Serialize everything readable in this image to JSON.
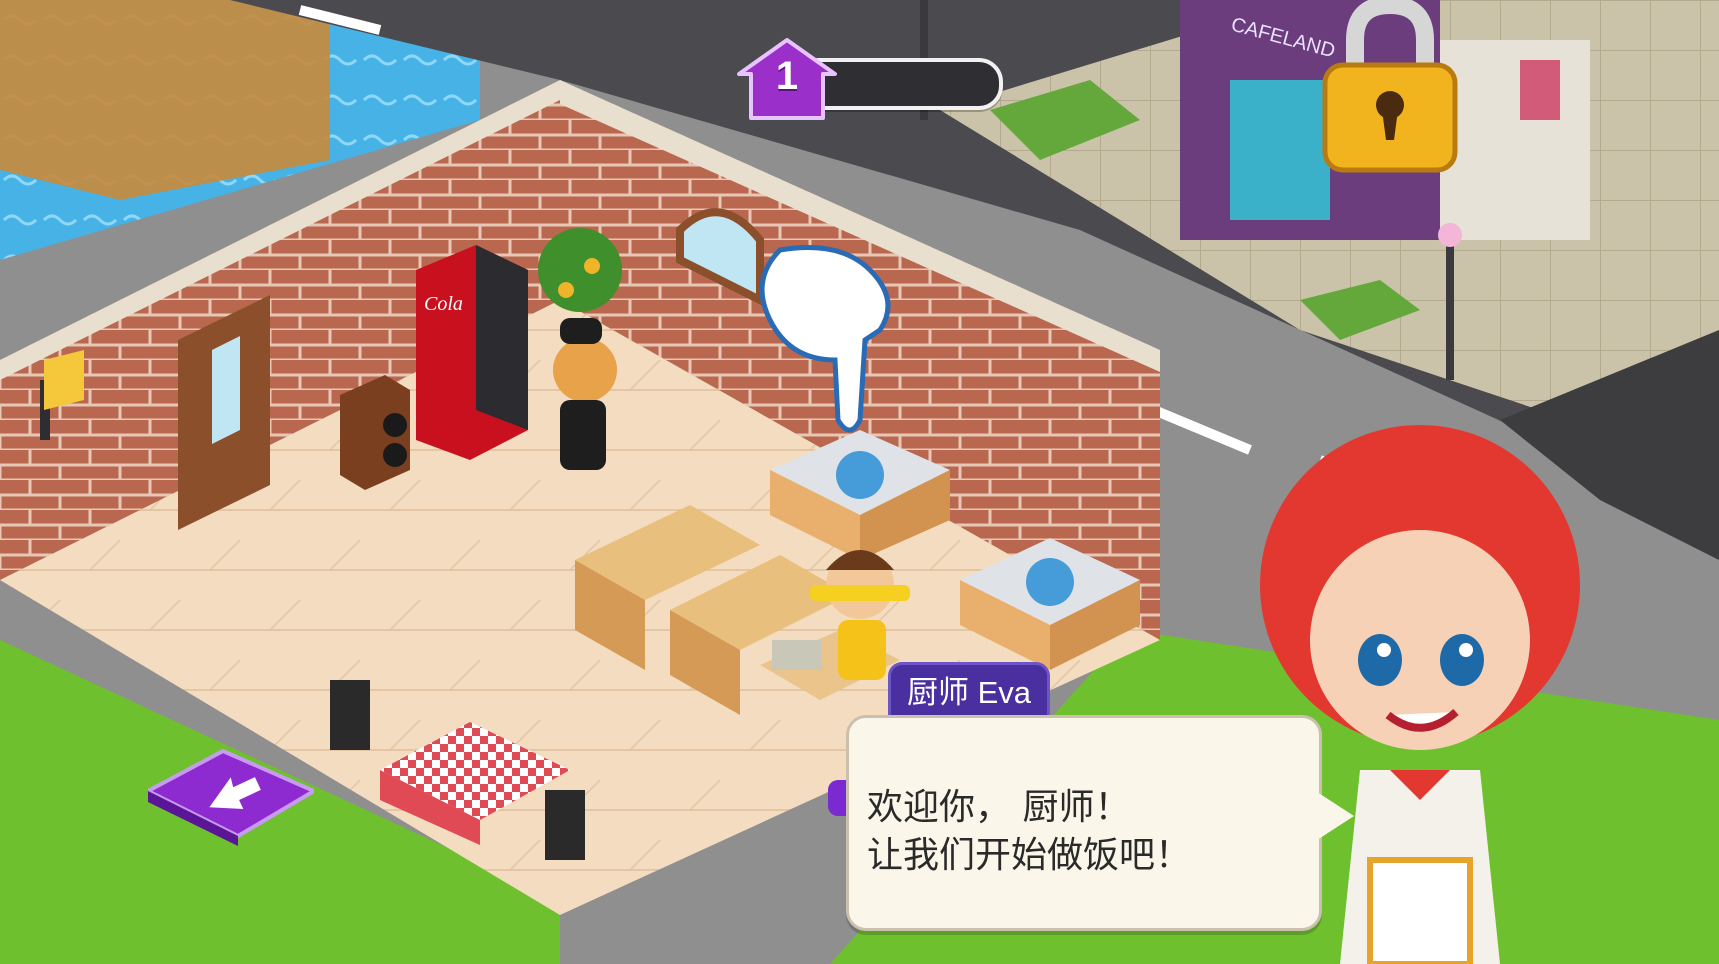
{
  "hud": {
    "level_number": "1",
    "level_progress": 0
  },
  "shop_sign": "CAFELAND",
  "vending_machine_brand": "Cola",
  "dialog": {
    "speaker": "厨师 Eva",
    "line1": "欢迎你， 厨师！",
    "line2": "让我们开始做饭吧！"
  },
  "colors": {
    "grass": "#6fc02f",
    "floor": "#f3d9b8",
    "brick": "#b96b55",
    "road": "#4a4a4f",
    "water": "#4fb8e8",
    "hud_purple": "#9b2fc9",
    "chef_hair": "#e2382f"
  },
  "icons": [
    "level-up-badge-icon",
    "padlock-icon",
    "back-arrow-icon",
    "pointing-hand-icon"
  ]
}
